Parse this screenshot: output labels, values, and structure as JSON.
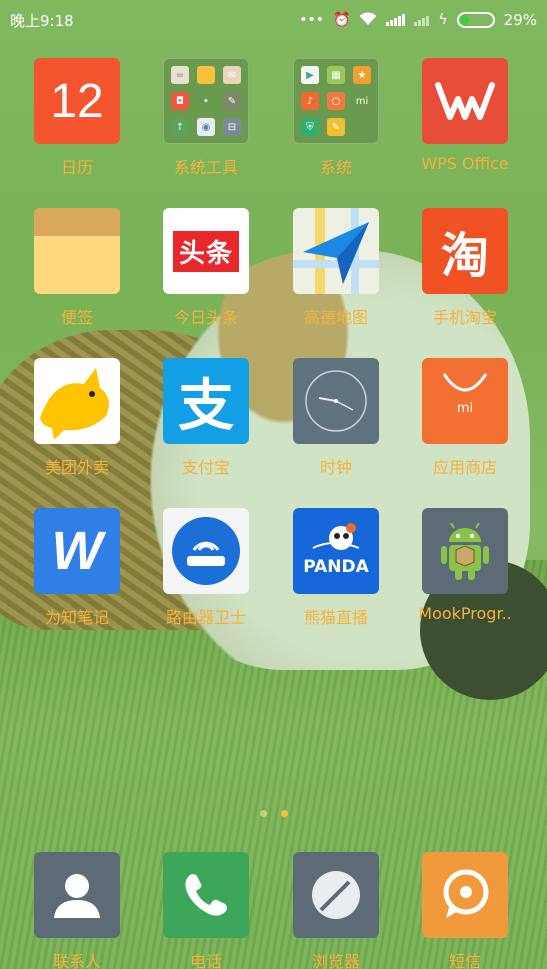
{
  "status_bar": {
    "time": "晚上9:18",
    "battery_percent": "29%",
    "battery_level": 0.29,
    "icons": [
      "more-icon",
      "alarm-icon",
      "wifi-icon",
      "signal-icon",
      "nosim-signal-icon",
      "charging-icon",
      "battery-icon"
    ]
  },
  "apps": [
    {
      "label": "日历",
      "icon": "calendar-icon",
      "icon_text": "12"
    },
    {
      "label": "系统工具",
      "icon": "folder-icon"
    },
    {
      "label": "系统",
      "icon": "folder-icon"
    },
    {
      "label": "WPS Office",
      "icon": "wps-icon"
    },
    {
      "label": "便签",
      "icon": "notes-icon"
    },
    {
      "label": "今日头条",
      "icon": "toutiao-icon",
      "icon_text": "头条"
    },
    {
      "label": "高德地图",
      "icon": "amap-icon"
    },
    {
      "label": "手机淘宝",
      "icon": "taobao-icon",
      "icon_text": "淘"
    },
    {
      "label": "美团外卖",
      "icon": "meituan-icon"
    },
    {
      "label": "支付宝",
      "icon": "alipay-icon",
      "icon_text": "支"
    },
    {
      "label": "时钟",
      "icon": "clock-icon"
    },
    {
      "label": "应用商店",
      "icon": "mi-store-icon",
      "icon_text": "mi"
    },
    {
      "label": "为知笔记",
      "icon": "wiznote-icon",
      "icon_text": "W"
    },
    {
      "label": "路由器卫士",
      "icon": "router-icon"
    },
    {
      "label": "熊猫直播",
      "icon": "panda-icon",
      "icon_text": "PANDA"
    },
    {
      "label": "MookProgr..",
      "icon": "android-icon"
    }
  ],
  "page_indicator": {
    "pages": 2,
    "current": 2
  },
  "dock": [
    {
      "label": "联系人",
      "icon": "contacts-icon"
    },
    {
      "label": "电话",
      "icon": "phone-icon"
    },
    {
      "label": "浏览器",
      "icon": "browser-icon"
    },
    {
      "label": "短信",
      "icon": "sms-icon"
    }
  ],
  "colors": {
    "label": "#f6b13e",
    "calendar": "#f4552f",
    "wps": "#e84d3a",
    "alipay": "#129fe6",
    "battery": "#3bd13b"
  }
}
